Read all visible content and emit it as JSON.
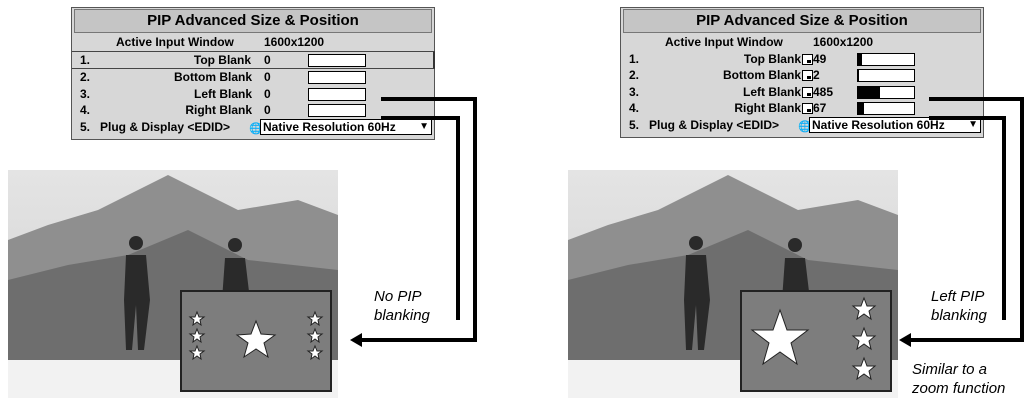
{
  "left_panel": {
    "title": "PIP Advanced Size & Position",
    "active_label": "Active Input Window",
    "active_value": "1600x1200",
    "rows": [
      {
        "num": "1.",
        "label": "Top Blank",
        "value": "0",
        "fill": 0
      },
      {
        "num": "2.",
        "label": "Bottom Blank",
        "value": "0",
        "fill": 0
      },
      {
        "num": "3.",
        "label": "Left Blank",
        "value": "0",
        "fill": 0
      },
      {
        "num": "4.",
        "label": "Right Blank",
        "value": "0",
        "fill": 0
      }
    ],
    "plug_num": "5.",
    "plug_label": "Plug & Display <EDID>",
    "plug_value": "Native Resolution 60Hz",
    "globe_icon": "globe-icon",
    "dropdown_icon": "triangle-down-icon"
  },
  "right_panel": {
    "title": "PIP Advanced Size & Position",
    "active_label": "Active Input Window",
    "active_value": "1600x1200",
    "rows": [
      {
        "num": "1.",
        "label": "Top Blank",
        "value": "49",
        "fill": 0.07
      },
      {
        "num": "2.",
        "label": "Bottom Blank",
        "value": "2",
        "fill": 0.02
      },
      {
        "num": "3.",
        "label": "Left Blank",
        "value": "485",
        "fill": 0.4
      },
      {
        "num": "4.",
        "label": "Right Blank",
        "value": "67",
        "fill": 0.1
      }
    ],
    "plug_num": "5.",
    "plug_label": "Plug & Display <EDID>",
    "plug_value": "Native Resolution 60Hz",
    "globe_icon": "globe-icon",
    "dropdown_icon": "triangle-down-icon"
  },
  "left_caption": {
    "line1": "No PIP",
    "line2": "blanking"
  },
  "right_caption": {
    "line1": "Left PIP",
    "line2": "blanking",
    "note1": "Similar to a",
    "note2": "zoom function"
  },
  "colors": {
    "panel_bg": "#d7d7d7",
    "pip_bg": "#7d7d7d",
    "star": "#ffffff"
  }
}
